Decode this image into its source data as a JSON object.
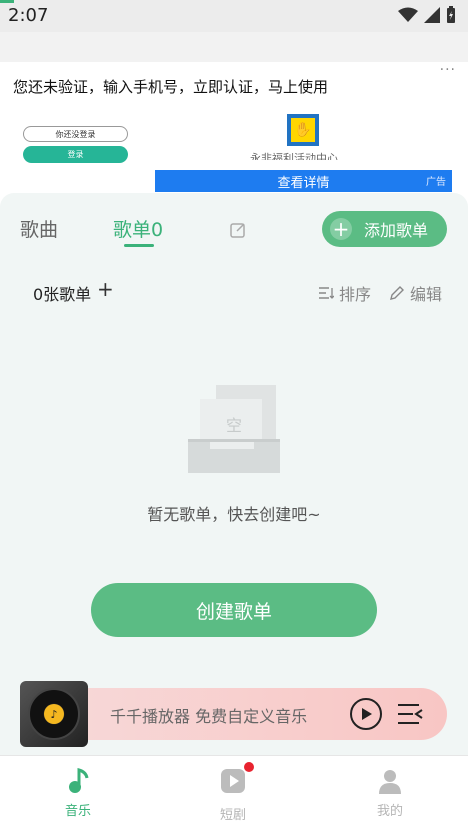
{
  "status_bar": {
    "time": "2:07"
  },
  "ad": {
    "headline": "您还未验证，输入手机号，立即认证，马上使用",
    "login_placeholder": "你还没登录",
    "login_button": "登录",
    "center_text": "永非福利活动中心",
    "details_button": "查看详情",
    "ad_tag": "广告",
    "menu": "···"
  },
  "tabs": {
    "songs": "歌曲",
    "playlists": "歌单0"
  },
  "add_playlist": {
    "label": "添加歌单"
  },
  "list_header": {
    "count": "0张歌单",
    "add": "+",
    "sort": "排序",
    "edit": "编辑"
  },
  "empty": {
    "badge": "空",
    "message": "暂无歌单，快去创建吧~"
  },
  "create_button": {
    "label": "创建歌单"
  },
  "player": {
    "text": "千千播放器 免费自定义音乐"
  },
  "bottom_nav": {
    "items": [
      {
        "label": "音乐",
        "color": "#3bb27a"
      },
      {
        "label": "短剧",
        "color": "#b5b5b5"
      },
      {
        "label": "我的",
        "color": "#b5b5b5"
      }
    ]
  },
  "colors": {
    "accent": "#3bb27a",
    "button": "#5bbc84",
    "badge": "#e8232f",
    "ad_blue": "#1e7cf0"
  }
}
